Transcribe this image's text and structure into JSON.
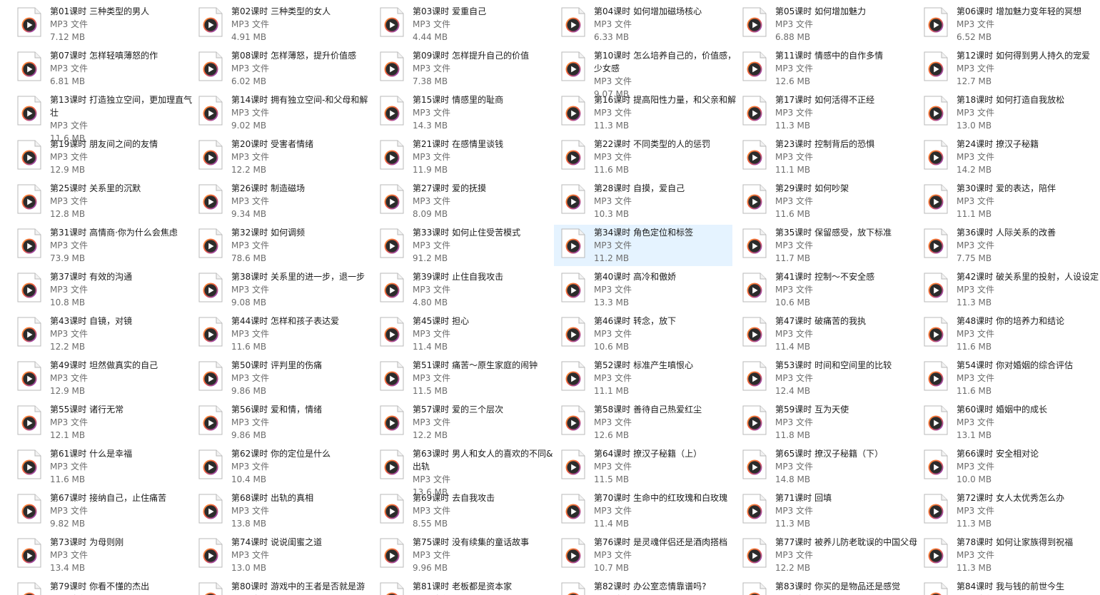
{
  "file_type": "MP3 文件",
  "selected_index": 33,
  "files": [
    {
      "name": "第01课时 三种类型的男人",
      "size": "7.12 MB"
    },
    {
      "name": "第02课时 三种类型的女人",
      "size": "4.91 MB"
    },
    {
      "name": "第03课时 爱重自己",
      "size": "4.44 MB"
    },
    {
      "name": "第04课时 如何增加磁场核心",
      "size": "6.33 MB"
    },
    {
      "name": "第05课时 如何增加魅力",
      "size": "6.88 MB"
    },
    {
      "name": "第06课时 增加魅力变年轻的冥想",
      "size": "6.52 MB"
    },
    {
      "name": "第07课时 怎样轻嗔薄怒的作",
      "size": "6.81 MB"
    },
    {
      "name": "第08课时 怎样薄怒，提升价值感",
      "size": "6.02 MB"
    },
    {
      "name": "第09课时 怎样提升自己的价值",
      "size": "7.38 MB"
    },
    {
      "name": "第10课时 怎么培养自己的，价值感，少女感",
      "size": "9.07 MB"
    },
    {
      "name": "第11课时 情感中的自作多情",
      "size": "12.6 MB"
    },
    {
      "name": "第12课时 如何得到男人持久的宠爱",
      "size": "12.7 MB"
    },
    {
      "name": "第13课时 打造独立空间，更加理直气壮",
      "size": "11.6 MB"
    },
    {
      "name": "第14课时 拥有独立空间-和父母和解",
      "size": "9.02 MB"
    },
    {
      "name": "第15课时 情感里的耻商",
      "size": "14.3 MB"
    },
    {
      "name": "第16课时 提高阳性力量，和父亲和解",
      "size": "11.3 MB"
    },
    {
      "name": "第17课时 如何活得不正经",
      "size": "11.3 MB"
    },
    {
      "name": "第18课时 如何打造自我放松",
      "size": "13.0 MB"
    },
    {
      "name": "第19课时 朋友间之间的友情",
      "size": "12.9 MB"
    },
    {
      "name": "第20课时 受害者情绪",
      "size": "12.2 MB"
    },
    {
      "name": "第21课时 在感情里谈钱",
      "size": "11.9 MB"
    },
    {
      "name": "第22课时 不同类型的人的惩罚",
      "size": "11.6 MB"
    },
    {
      "name": "第23课时 控制背后的恐惧",
      "size": "11.1 MB"
    },
    {
      "name": "第24课时 撩汉子秘籍",
      "size": "14.2 MB"
    },
    {
      "name": "第25课时 关系里的沉默",
      "size": "12.8 MB"
    },
    {
      "name": "第26课时 制造磁场",
      "size": "9.34 MB"
    },
    {
      "name": "第27课时 爱的抚摸",
      "size": "8.09 MB"
    },
    {
      "name": "第28课时 自摸，爱自己",
      "size": "10.3 MB"
    },
    {
      "name": "第29课时 如何吵架",
      "size": "11.6 MB"
    },
    {
      "name": "第30课时 爱的表达，陪伴",
      "size": "11.1 MB"
    },
    {
      "name": "第31课时 高情商·你为什么会焦虑",
      "size": "73.9 MB"
    },
    {
      "name": "第32课时 如何调频",
      "size": "78.6 MB"
    },
    {
      "name": "第33课时 如何止住受苦模式",
      "size": "91.2 MB"
    },
    {
      "name": "第34课时 角色定位和标签",
      "size": "11.2 MB"
    },
    {
      "name": "第35课时 保留感受，放下标准",
      "size": "11.7 MB"
    },
    {
      "name": "第36课时 人际关系的改善",
      "size": "7.75 MB"
    },
    {
      "name": "第37课时 有效的沟通",
      "size": "10.8 MB"
    },
    {
      "name": "第38课时 关系里的进一步，退一步",
      "size": "9.08 MB"
    },
    {
      "name": "第39课时 止住自我攻击",
      "size": "4.80 MB"
    },
    {
      "name": "第40课时 高冷和傲娇",
      "size": "13.3 MB"
    },
    {
      "name": "第41课时  控制～不安全感",
      "size": "10.6 MB"
    },
    {
      "name": "第42课时 破关系里的投射，人设设定",
      "size": "11.3 MB"
    },
    {
      "name": "第43课时 自镜，对镜",
      "size": "12.2 MB"
    },
    {
      "name": "第44课时 怎样和孩子表达爱",
      "size": "11.6 MB"
    },
    {
      "name": "第45课时 担心",
      "size": "11.4 MB"
    },
    {
      "name": "第46课时 转念，放下",
      "size": "10.6 MB"
    },
    {
      "name": "第47课时 破痛苦的我执",
      "size": "11.4 MB"
    },
    {
      "name": "第48课时 你的培养力和结论",
      "size": "11.6 MB"
    },
    {
      "name": "第49课时 坦然做真实的自己",
      "size": "12.9 MB"
    },
    {
      "name": "第50课时 评判里的伤痛",
      "size": "9.86 MB"
    },
    {
      "name": "第51课时 痛苦～原生家庭的闹钟",
      "size": "11.5 MB"
    },
    {
      "name": "第52课时 标准产生嗔恨心",
      "size": "11.1 MB"
    },
    {
      "name": "第53课时 时间和空间里的比较",
      "size": "12.4 MB"
    },
    {
      "name": "第54课时 你对婚姻的综合评估",
      "size": "11.6 MB"
    },
    {
      "name": "第55课时 诸行无常",
      "size": "12.1 MB"
    },
    {
      "name": "第56课时 爱和情，情绪",
      "size": "9.86 MB"
    },
    {
      "name": "第57课时 爱的三个层次",
      "size": "12.2 MB"
    },
    {
      "name": "第58课时 善待自己热爱红尘",
      "size": "12.6 MB"
    },
    {
      "name": "第59课时 互为天使",
      "size": "11.8 MB"
    },
    {
      "name": "第60课时 婚姻中的成长",
      "size": "13.1 MB"
    },
    {
      "name": "第61课时 什么是幸福",
      "size": "11.6 MB"
    },
    {
      "name": "第62课时 你的定位是什么",
      "size": "10.4 MB"
    },
    {
      "name": "第63课时 男人和女人的喜欢的不同&出轨",
      "size": "13.6 MB"
    },
    {
      "name": "第64课时 撩汉子秘籍（上）",
      "size": "11.5 MB"
    },
    {
      "name": "第65课时 撩汉子秘籍（下）",
      "size": "14.8 MB"
    },
    {
      "name": "第66课时 安全相对论",
      "size": "10.0 MB"
    },
    {
      "name": "第67课时 接纳自己，止住痛苦",
      "size": "9.82 MB"
    },
    {
      "name": "第68课时 出轨的真相",
      "size": "13.8 MB"
    },
    {
      "name": "第69课时 去自我攻击",
      "size": "8.55 MB"
    },
    {
      "name": "第70课时 生命中的红玫瑰和白玫瑰",
      "size": "11.4 MB"
    },
    {
      "name": "第71课时 回填",
      "size": "11.3 MB"
    },
    {
      "name": "第72课时 女人太优秀怎么办",
      "size": "11.3 MB"
    },
    {
      "name": "第73课时 为母则刚",
      "size": "13.4 MB"
    },
    {
      "name": "第74课时 说说闺蜜之道",
      "size": "13.0 MB"
    },
    {
      "name": "第75课时 没有续集的童话故事",
      "size": "9.96 MB"
    },
    {
      "name": "第76课时 是灵魂伴侣还是酒肉搭档",
      "size": "10.7 MB"
    },
    {
      "name": "第77课时 被养儿防老耽误的中国父母",
      "size": "12.2 MB"
    },
    {
      "name": "第78课时 如何让家族得到祝福",
      "size": "11.3 MB"
    },
    {
      "name": "第79课时 你看不懂的杰出",
      "size": ""
    },
    {
      "name": "第80课时 游戏中的王者是否就是游",
      "size": ""
    },
    {
      "name": "第81课时 老板都是资本家",
      "size": ""
    },
    {
      "name": "第82课时 办公室恋情靠谱吗?",
      "size": ""
    },
    {
      "name": "第83课时 你买的是物品还是感觉",
      "size": ""
    },
    {
      "name": "第84课时 我与钱的前世今生",
      "size": ""
    }
  ]
}
